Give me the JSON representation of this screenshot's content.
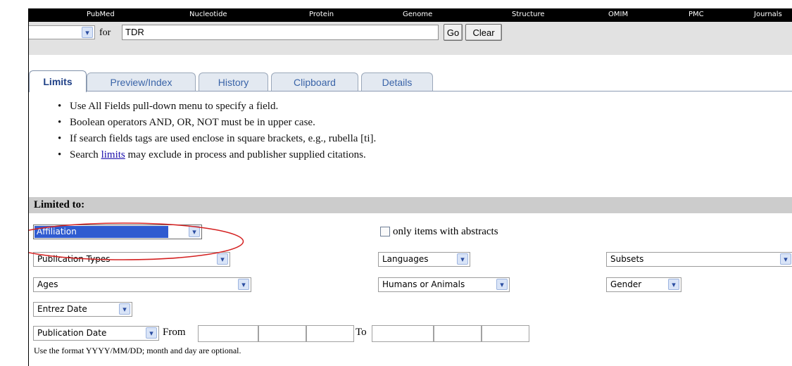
{
  "nav": [
    "PubMed",
    "Nucleotide",
    "Protein",
    "Genome",
    "Structure",
    "OMIM",
    "PMC",
    "Journals"
  ],
  "search": {
    "for_label": "for",
    "term": "TDR",
    "go_label": "Go",
    "clear_label": "Clear"
  },
  "tabs": [
    "Limits",
    "Preview/Index",
    "History",
    "Clipboard",
    "Details"
  ],
  "tips": {
    "t1": "Use All Fields pull-down menu to specify a field.",
    "t2": "Boolean operators AND, OR, NOT must be in upper case.",
    "t3": "If search fields tags are used enclose in square brackets, e.g., rubella [ti].",
    "t4_pre": "Search ",
    "t4_link": "limits",
    "t4_post": " may exclude in process and publisher supplied citations."
  },
  "limits": {
    "title": "Limited to:",
    "field_select": "Affiliation",
    "abstracts_label": "only items with abstracts",
    "publication_types": "Publication Types",
    "languages": "Languages",
    "subsets": "Subsets",
    "ages": "Ages",
    "humans_animals": "Humans or Animals",
    "gender": "Gender",
    "entrez_date": "Entrez Date",
    "publication_date": "Publication Date",
    "from_label": "From",
    "to_label": "To",
    "format_note": "Use the format YYYY/MM/DD; month and day are optional."
  },
  "colors": {
    "highlight": "#2f5bd0",
    "annotation": "#d42020",
    "tab_text": "#3a64a8"
  }
}
